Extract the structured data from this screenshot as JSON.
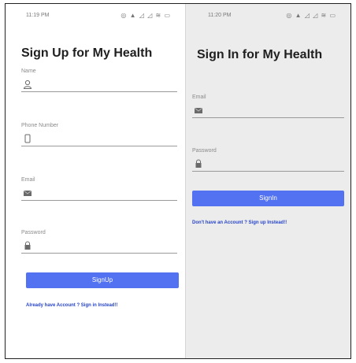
{
  "signup": {
    "status_time": "11:19 PM",
    "status_icons": "◎ ▲ ◿ ◿ ≋ ▭",
    "title": "Sign Up for My Health",
    "name_label": "Name",
    "phone_label": "Phone Number",
    "email_label": "Email",
    "password_label": "Password",
    "button_label": "SignUp",
    "link_text": "Already have Account ? Sign in Instead!!"
  },
  "signin": {
    "status_time": "11:20 PM",
    "status_icons": "◎ ▲ ◿ ◿ ≋ ▭",
    "title": "Sign In for My Health",
    "email_label": "Email",
    "password_label": "Password",
    "button_label": "SignIn",
    "link_text": "Don't have an Account ? Sign up Instead!!"
  },
  "icons": [
    "user-icon",
    "phone-icon",
    "mail-icon",
    "lock-icon"
  ],
  "colors": {
    "button": "#5272f2",
    "link": "#2845c8",
    "right_bg": "#ececec"
  }
}
